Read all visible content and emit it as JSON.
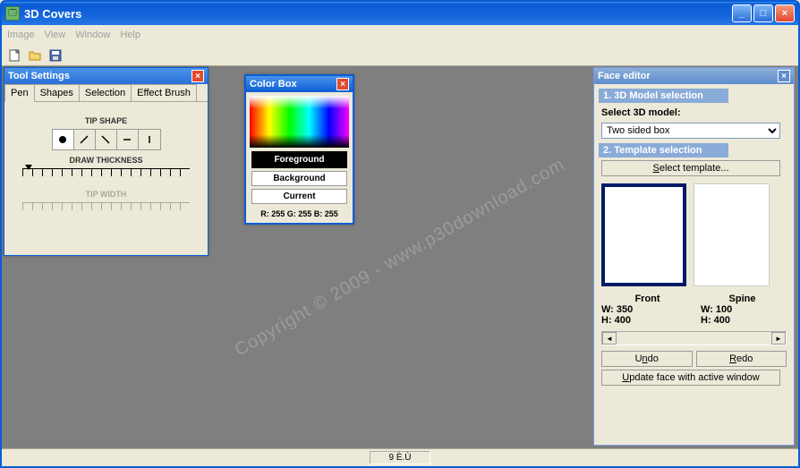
{
  "window": {
    "title": "3D Covers"
  },
  "menu": {
    "image": "Image",
    "view": "View",
    "window": "Window",
    "help": "Help"
  },
  "toolSettings": {
    "title": "Tool Settings",
    "tabs": {
      "pen": "Pen",
      "shapes": "Shapes",
      "selection": "Selection",
      "effectBrush": "Effect Brush"
    },
    "tipShape": "TIP SHAPE",
    "drawThickness": "DRAW THICKNESS",
    "tipWidth": "TIP WIDTH"
  },
  "colorBox": {
    "title": "Color Box",
    "foreground": "Foreground",
    "background": "Background",
    "current": "Current",
    "rgb": "R: 255 G: 255 B: 255"
  },
  "faceEditor": {
    "title": "Face editor",
    "section1": "1. 3D Model selection",
    "selectModelLabel": "Select 3D model:",
    "selectedModel": "Two sided box",
    "section2": "2. Template selection",
    "selectTemplate": "Select template...",
    "front": {
      "label": "Front",
      "w": "W: 350",
      "h": "H: 400"
    },
    "spine": {
      "label": "Spine",
      "w": "W: 100",
      "h": "H: 400"
    },
    "undo": "Undo",
    "redo": "Redo",
    "updateFace": "Update face with active window"
  },
  "statusbar": {
    "text": "9 È.Ù"
  },
  "watermark": "Copyright © 2009 - www.p30download.com"
}
